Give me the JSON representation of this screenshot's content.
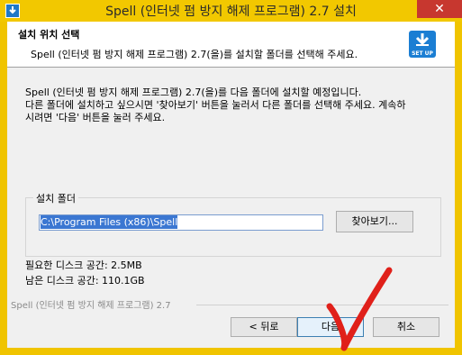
{
  "window": {
    "title": "Spell (인터넷 펌 방지 해제 프로그램) 2.7 설치",
    "close_glyph": "✕"
  },
  "header": {
    "title": "설치 위치 선택",
    "subtitle": "Spell (인터넷 펌 방지 해제 프로그램) 2.7(을)를 설치할 폴더를 선택해 주세요.",
    "logo_text": "SET UP"
  },
  "description": [
    "Spell (인터넷 펌 방지 해제 프로그램) 2.7(을)를 다음 폴더에 설치할 예정입니다.",
    "다른 폴더에 설치하고 싶으시면 '찾아보기' 버튼을 눌러서 다른 폴더를 선택해 주세요. 계속하",
    "시려면 '다음' 버튼을 눌러 주세요."
  ],
  "install_folder": {
    "group_label": "설치 폴더",
    "path": "C:\\Program Files (x86)\\Spell",
    "browse_label": "찾아보기..."
  },
  "space": {
    "required": "필요한 디스크 공간: 2.5MB",
    "available": "남은 디스크 공간: 110.1GB"
  },
  "branding": "Spell (인터넷 펌 방지 해제 프로그램) 2.7",
  "buttons": {
    "back": "< 뒤로",
    "next": "다음",
    "cancel": "취소"
  },
  "colors": {
    "title_bar": "#f2c800",
    "close": "#c7372f",
    "selection": "#3b77d2",
    "annotation": "#e0201a"
  },
  "icons": {
    "title": "installer-icon",
    "logo": "setup-download-icon",
    "annotation": "red-checkmark"
  }
}
